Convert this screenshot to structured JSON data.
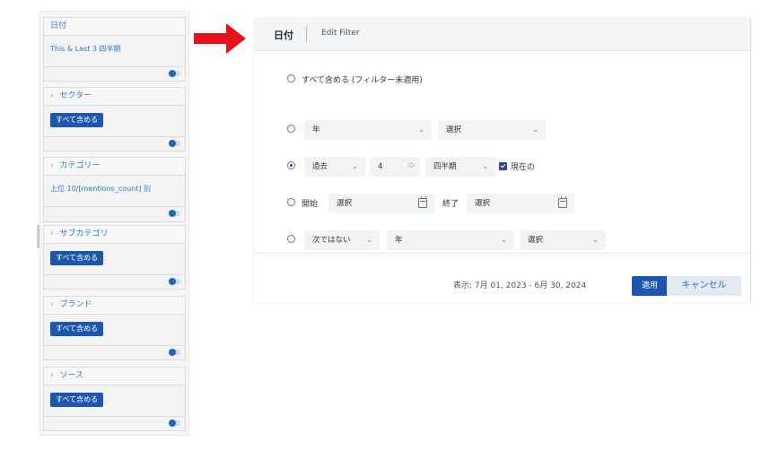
{
  "sidebar": {
    "panels": [
      {
        "title": "日付",
        "value": "This & Last 3 四半期",
        "kind": "text"
      },
      {
        "title": "セクター",
        "value": "すべて含める",
        "kind": "button"
      },
      {
        "title": "カテゴリー",
        "value": "上位 10/[mentions_count] 別",
        "kind": "text"
      },
      {
        "title": "サブカテゴリ",
        "value": "すべて含める",
        "kind": "button"
      },
      {
        "title": "ブランド",
        "value": "すべて含める",
        "kind": "button"
      },
      {
        "title": "ソース",
        "value": "すべて含める",
        "kind": "button"
      }
    ]
  },
  "dialog": {
    "title": "日付",
    "edit_label": "Edit Filter",
    "option_all": "すべて含める (フィルター未適用)",
    "row_year": {
      "unit": "年",
      "select": "選択"
    },
    "row_past": {
      "mode": "過去",
      "count": "4",
      "unit": "四半期",
      "current_label": "現在の"
    },
    "row_range": {
      "start_label": "開始",
      "start_value": "選択",
      "end_label": "終了",
      "end_value": "選択"
    },
    "row_not": {
      "mode": "次ではない",
      "unit": "年",
      "select": "選択"
    },
    "footer": {
      "range_text": "表示:   7月 01, 2023 - 6月 30, 2024",
      "apply": "適用",
      "cancel": "キャンセル"
    }
  },
  "colors": {
    "accent": "#1d56ae",
    "link": "#2c78d4",
    "arrow": "#e8101a"
  }
}
